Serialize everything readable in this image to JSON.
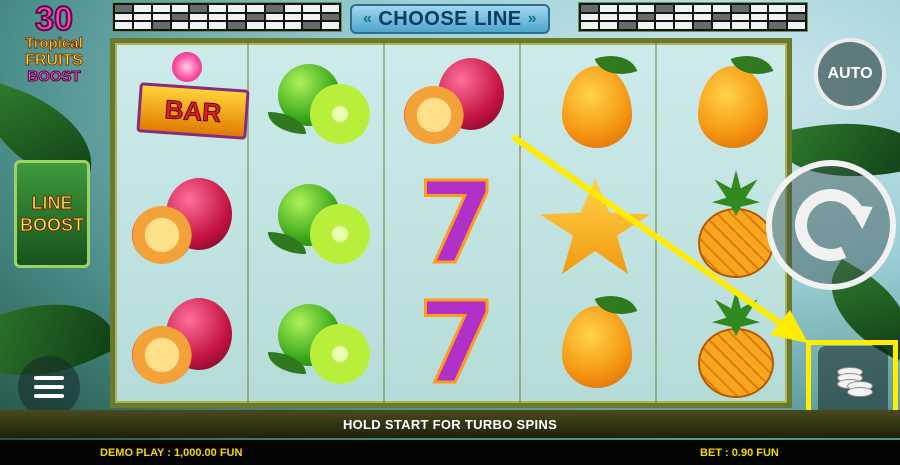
{
  "logo": {
    "number": "30",
    "line1": "Tropical",
    "line2": "FRUITS",
    "line3": "BOOST"
  },
  "line_boost": {
    "line1": "LINE",
    "line2": "BOOST"
  },
  "header": {
    "choose_line_label": "CHOOSE LINE",
    "left_arrow": "«",
    "right_arrow": "»"
  },
  "paylines": {
    "left_strip_count": 12,
    "right_strip_count": 12
  },
  "reels": [
    {
      "symbols": [
        "bar",
        "passion-fruit",
        "passion-fruit"
      ]
    },
    {
      "symbols": [
        "lime",
        "lime",
        "lime"
      ]
    },
    {
      "symbols": [
        "passion-fruit",
        "seven",
        "seven"
      ]
    },
    {
      "symbols": [
        "mango",
        "star-fruit",
        "mango"
      ]
    },
    {
      "symbols": [
        "mango",
        "pineapple",
        "pineapple"
      ]
    }
  ],
  "symbol_text": {
    "bar": "BAR",
    "seven": "7"
  },
  "controls": {
    "auto_label": "AUTO",
    "spin_icon": "spin-icon",
    "coins_icon": "coin-stack-icon",
    "menu_icon": "hamburger-menu-icon"
  },
  "status": {
    "hold_message": "HOLD START FOR TURBO SPINS"
  },
  "footer": {
    "demo_play": "DEMO PLAY : 1,000.00 FUN",
    "bet": "BET : 0.90 FUN"
  },
  "colors": {
    "highlight": "#ffec00",
    "footer_text": "#f5d800"
  }
}
